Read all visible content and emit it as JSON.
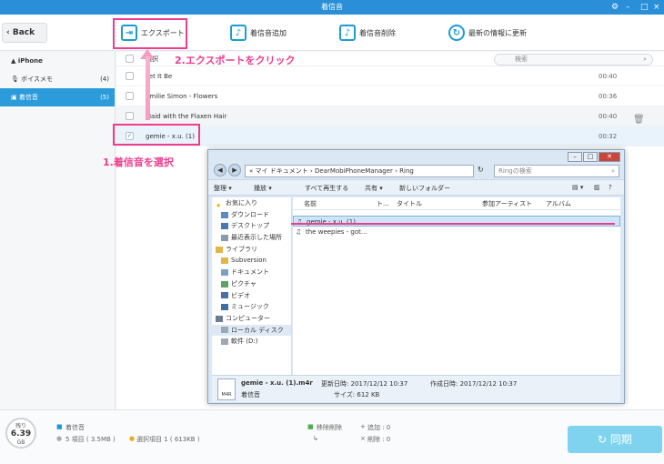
{
  "window": {
    "title": "着信音"
  },
  "toolbar": {
    "back_label": "Back",
    "export_label": "エクスポート",
    "add_label": "着信音追加",
    "delete_label": "着信音削除",
    "refresh_label": "最新の情報に更新"
  },
  "sidebar": {
    "device": "iPhone",
    "items": [
      {
        "label": "ボイスメモ",
        "count": "(4)"
      },
      {
        "label": "着信音",
        "count": "(5)"
      }
    ]
  },
  "list": {
    "select_all": "選択",
    "search_placeholder": "検索",
    "rows": [
      {
        "name": "Let It Be",
        "duration": "00:40"
      },
      {
        "name": "Emilie Simon - Flowers",
        "duration": "00:36"
      },
      {
        "name": "Maid with the Flaxen Hair",
        "duration": "00:40"
      },
      {
        "name": "gemie - x.u. (1)",
        "duration": "00:32"
      }
    ]
  },
  "annotations": {
    "step1": "1.着信音を選択",
    "step2": "2.エクスポートをクリック"
  },
  "explorer": {
    "path": "« マイ ドキュメント › DearMobiPhoneManager › Ring",
    "search_placeholder": "Ringの検索",
    "commands": [
      "整理 ▾",
      "播放 ▾",
      "すべて再生する",
      "共有 ▾",
      "新しいフォルダー"
    ],
    "nav": [
      "お気に入り",
      "ダウンロード",
      "デスクトップ",
      "最近表示した場所",
      "ライブラリ",
      "Subversion",
      "ドキュメント",
      "ピクチャ",
      "ビデオ",
      "ミュージック",
      "コンピューター",
      "ローカル ディスク",
      "軟件 (D:)"
    ],
    "columns": [
      "名前",
      "ト...",
      "タイトル",
      "参加アーティスト",
      "アルバム"
    ],
    "files": [
      "gemie - x.u. (1)....",
      "the weepies - got..."
    ],
    "details": {
      "filename": "gemie - x.u. (1).m4r",
      "updated_label": "更新日時: 2017/12/12 10:37",
      "created_label": "作成日時: 2017/12/12 10:37",
      "type": "着信音",
      "size_label": "サイズ: 612 KB",
      "file_icon_text": "M4R"
    }
  },
  "footer": {
    "storage_label": "残り",
    "storage_value": "6.39",
    "storage_unit": "GB",
    "category": "着信音",
    "items_summary": "5 項目 ( 3.5MB )",
    "selected_summary": "選択項目 1 ( 613KB )",
    "sync_delete": "移除削除",
    "add_count": "追加 : 0",
    "delete_count": "削除 : 0",
    "sync_label": "同期"
  },
  "colors": {
    "accent": "#1d9bd6",
    "highlight": "#ee3d8e",
    "sidebar_active": "#2c9bd9"
  }
}
